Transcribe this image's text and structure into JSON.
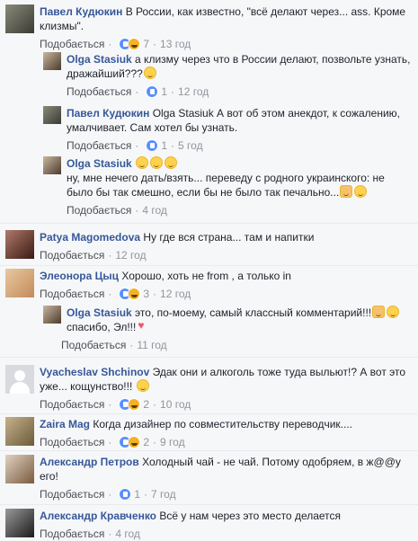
{
  "comments": [
    {
      "name": "Павел Кудюкин",
      "text": "В России, как известно, \"всё делают через... ass. Кроме клизмы\".",
      "like": "Подобається",
      "count": "7",
      "time": "13 год",
      "reactions": [
        "like",
        "haha"
      ]
    },
    {
      "name": "Olga Stasiuk",
      "text": "а клизму через что в России делают, позвольте узнать, дражайший???",
      "like": "Подобається",
      "count": "1",
      "time": "12 год",
      "reactions": [
        "like"
      ]
    },
    {
      "name": "Павел Кудюкин",
      "text": "Olga Stasiuk А вот об этом анекдот, к сожалению, умалчивает. Сам хотел бы узнать.",
      "like": "Подобається",
      "count": "1",
      "time": "5 год",
      "reactions": [
        "like"
      ]
    },
    {
      "name": "Olga Stasiuk",
      "text": "ну, мне нечего дать/взять... переведу с родного украинского: не было бы так смешно, если бы не было так печально...",
      "like": "Подобається",
      "time": "4 год"
    },
    {
      "name": "Patya Magomedova",
      "text": "Ну где вся страна... там и напитки",
      "like": "Подобається",
      "time": "12 год"
    },
    {
      "name": "Элеонора Цыц",
      "text": "Хорошо, хоть не from , а только in",
      "like": "Подобається",
      "count": "3",
      "time": "12 год",
      "reactions": [
        "like",
        "haha"
      ]
    },
    {
      "name": "Olga Stasiuk",
      "text": "это, по-моему, самый классный комментарий!!!",
      "text2": "спасибо, Эл!!!",
      "like": "Подобається",
      "time": "11 год"
    },
    {
      "name": "Vyacheslav Shchinov",
      "text": "Эдак они и алкоголь тоже туда выльют!? А вот это уже... кощунство!!!",
      "like": "Подобається",
      "count": "2",
      "time": "10 год",
      "reactions": [
        "like",
        "haha"
      ]
    },
    {
      "name": "Zaira Mag",
      "text": "Когда дизайнер по совместительству переводчик....",
      "like": "Подобається",
      "count": "2",
      "time": "9 год",
      "reactions": [
        "like",
        "haha"
      ]
    },
    {
      "name": "Александр Петров",
      "text": "Холодный чай - не чай. Потому одобряем, в ж@@у его!",
      "like": "Подобається",
      "count": "1",
      "time": "7 год",
      "reactions": [
        "like"
      ]
    },
    {
      "name": "Александр Кравченко",
      "text": "Всё у нам через это место делается",
      "like": "Подобається",
      "time": "4 год"
    }
  ],
  "colors": {
    "link": "#365899",
    "meta": "#90949c",
    "bg": "#f6f7f9"
  }
}
